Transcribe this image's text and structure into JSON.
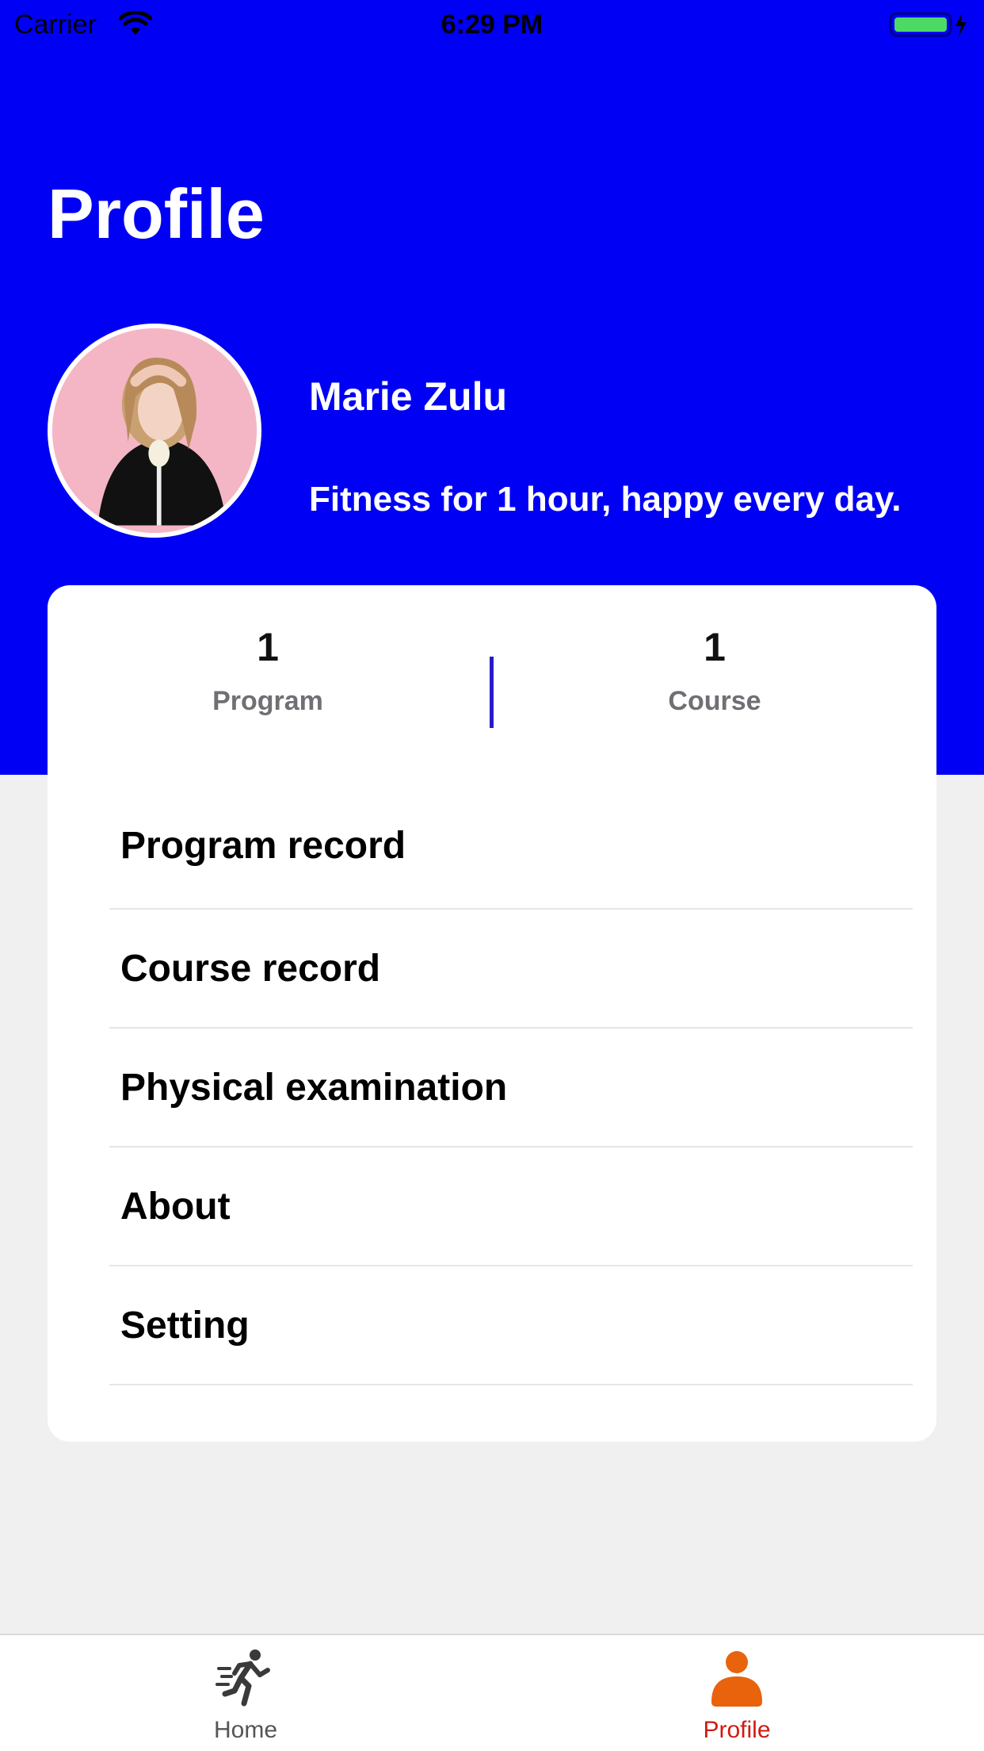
{
  "status_bar": {
    "carrier": "Carrier",
    "time": "6:29 PM",
    "icons": [
      "wifi-icon",
      "battery-icon",
      "charging-bolt-icon"
    ]
  },
  "header": {
    "title": "Profile",
    "background_color": "#0000f5"
  },
  "user": {
    "name": "Marie Zulu",
    "motto": "Fitness for 1 hour, happy every day.",
    "avatar_icon": "avatar-photo"
  },
  "stats": {
    "program": {
      "value": "1",
      "label": "Program"
    },
    "course": {
      "value": "1",
      "label": "Course"
    },
    "divider_color": "#2a1bc8"
  },
  "menu": {
    "items": [
      {
        "label": "Program record"
      },
      {
        "label": "Course record"
      },
      {
        "label": "Physical examination"
      },
      {
        "label": "About"
      },
      {
        "label": "Setting"
      }
    ]
  },
  "tab_bar": {
    "tabs": [
      {
        "label": "Home",
        "icon": "running-person-icon",
        "active": false
      },
      {
        "label": "Profile",
        "icon": "person-icon",
        "active": true
      }
    ],
    "active_color": "#d11a12",
    "active_icon_color": "#e8630c"
  }
}
